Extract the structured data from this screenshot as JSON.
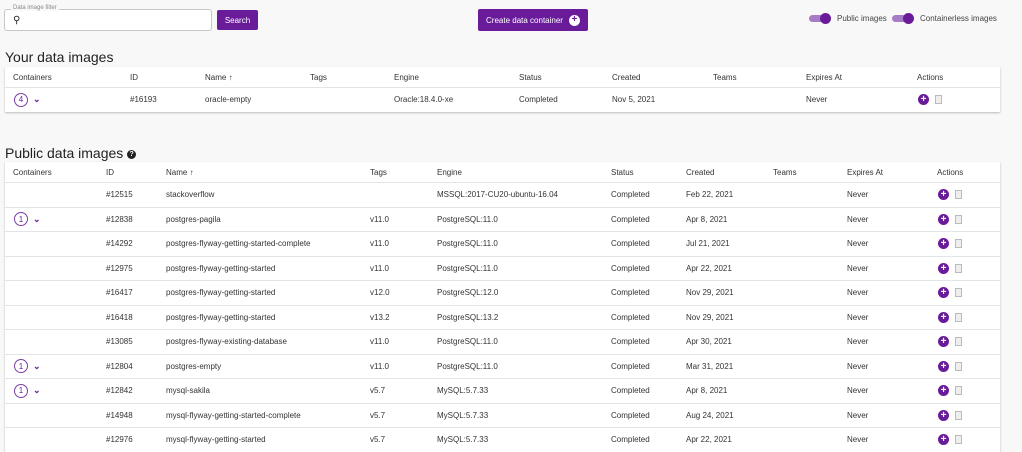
{
  "filter": {
    "label": "Data image filter",
    "value": "",
    "search_label": "Search"
  },
  "create_label": "Create data container",
  "toggles": {
    "public": "Public images",
    "containerless": "Containerless images"
  },
  "your": {
    "title": "Your data images",
    "headers": [
      "Containers",
      "ID",
      "Name ↑",
      "Tags",
      "Engine",
      "Status",
      "Created",
      "Teams",
      "Expires At",
      "Actions"
    ],
    "rows": [
      {
        "containers": "4",
        "id": "#16193",
        "name": "oracle-empty",
        "tags": "",
        "engine": "Oracle:18.4.0-xe",
        "status": "Completed",
        "created": "Nov 5, 2021",
        "teams": "",
        "expires": "Never"
      }
    ]
  },
  "public": {
    "title": "Public data images",
    "headers": [
      "Containers",
      "ID",
      "Name ↑",
      "Tags",
      "Engine",
      "Status",
      "Created",
      "Teams",
      "Expires At",
      "Actions"
    ],
    "rows": [
      {
        "containers": "",
        "id": "#12515",
        "name": "stackoverflow",
        "tags": "",
        "engine": "MSSQL:2017-CU20-ubuntu-16.04",
        "status": "Completed",
        "created": "Feb 22, 2021",
        "teams": "",
        "expires": "Never"
      },
      {
        "containers": "1",
        "id": "#12838",
        "name": "postgres-pagila",
        "tags": "v11.0",
        "engine": "PostgreSQL:11.0",
        "status": "Completed",
        "created": "Apr 8, 2021",
        "teams": "",
        "expires": "Never"
      },
      {
        "containers": "",
        "id": "#14292",
        "name": "postgres-flyway-getting-started-complete",
        "tags": "v11.0",
        "engine": "PostgreSQL:11.0",
        "status": "Completed",
        "created": "Jul 21, 2021",
        "teams": "",
        "expires": "Never"
      },
      {
        "containers": "",
        "id": "#12975",
        "name": "postgres-flyway-getting-started",
        "tags": "v11.0",
        "engine": "PostgreSQL:11.0",
        "status": "Completed",
        "created": "Apr 22, 2021",
        "teams": "",
        "expires": "Never"
      },
      {
        "containers": "",
        "id": "#16417",
        "name": "postgres-flyway-getting-started",
        "tags": "v12.0",
        "engine": "PostgreSQL:12.0",
        "status": "Completed",
        "created": "Nov 29, 2021",
        "teams": "",
        "expires": "Never"
      },
      {
        "containers": "",
        "id": "#16418",
        "name": "postgres-flyway-getting-started",
        "tags": "v13.2",
        "engine": "PostgreSQL:13.2",
        "status": "Completed",
        "created": "Nov 29, 2021",
        "teams": "",
        "expires": "Never"
      },
      {
        "containers": "",
        "id": "#13085",
        "name": "postgres-flyway-existing-database",
        "tags": "v11.0",
        "engine": "PostgreSQL:11.0",
        "status": "Completed",
        "created": "Apr 30, 2021",
        "teams": "",
        "expires": "Never"
      },
      {
        "containers": "1",
        "id": "#12804",
        "name": "postgres-empty",
        "tags": "v11.0",
        "engine": "PostgreSQL:11.0",
        "status": "Completed",
        "created": "Mar 31, 2021",
        "teams": "",
        "expires": "Never"
      },
      {
        "containers": "1",
        "id": "#12842",
        "name": "mysql-sakila",
        "tags": "v5.7",
        "engine": "MySQL:5.7.33",
        "status": "Completed",
        "created": "Apr 8, 2021",
        "teams": "",
        "expires": "Never"
      },
      {
        "containers": "",
        "id": "#14948",
        "name": "mysql-flyway-getting-started-complete",
        "tags": "v5.7",
        "engine": "MySQL:5.7.33",
        "status": "Completed",
        "created": "Aug 24, 2021",
        "teams": "",
        "expires": "Never"
      },
      {
        "containers": "",
        "id": "#12976",
        "name": "mysql-flyway-getting-started",
        "tags": "v5.7",
        "engine": "MySQL:5.7.33",
        "status": "Completed",
        "created": "Apr 22, 2021",
        "teams": "",
        "expires": "Never"
      }
    ]
  }
}
